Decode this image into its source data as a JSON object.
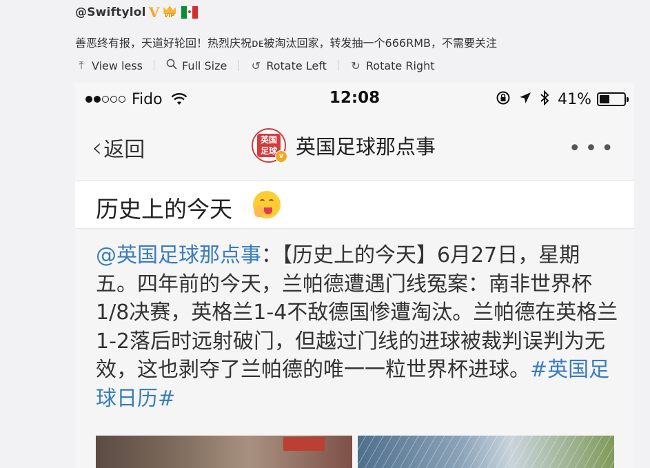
{
  "post": {
    "username": "@Swiftylol",
    "badge_v": "V",
    "badge_vip": "VIP",
    "text": "善恶终有报，天道好轮回！热烈庆祝ᴅᴇ被淘汰回家，转发抽一个666RMB，不需要关注"
  },
  "toolbar": {
    "view_less": "View less",
    "full_size": "Full Size",
    "rotate_left": "Rotate Left",
    "rotate_right": "Rotate Right"
  },
  "phone": {
    "carrier": "Fido",
    "time": "12:08",
    "battery_pct": "41%",
    "battery_level": 0.41,
    "back_label": "返回",
    "account_name": "英国足球那点事",
    "avatar_text": "英国足球",
    "more": "•••",
    "post_title": "历史上的今天",
    "mention": "@英国足球那点事",
    "body": "：【历史上的今天】6月27日，星期五。四年前的今天，兰帕德遭遇门线冤案：南非世界杯1/8决赛，英格兰1-4不敌德国惨遭淘汰。兰帕德在英格兰1-2落后时远射破门，但越过门线的进球被裁判误判为无效，这也剥夺了兰帕德的唯一一粒世界杯进球。",
    "hashtag": "#英国足球日历#"
  },
  "colors": {
    "link": "#3a7dbf",
    "badge_gold": "#f5a623",
    "avatar_red": "#d43b3b"
  }
}
